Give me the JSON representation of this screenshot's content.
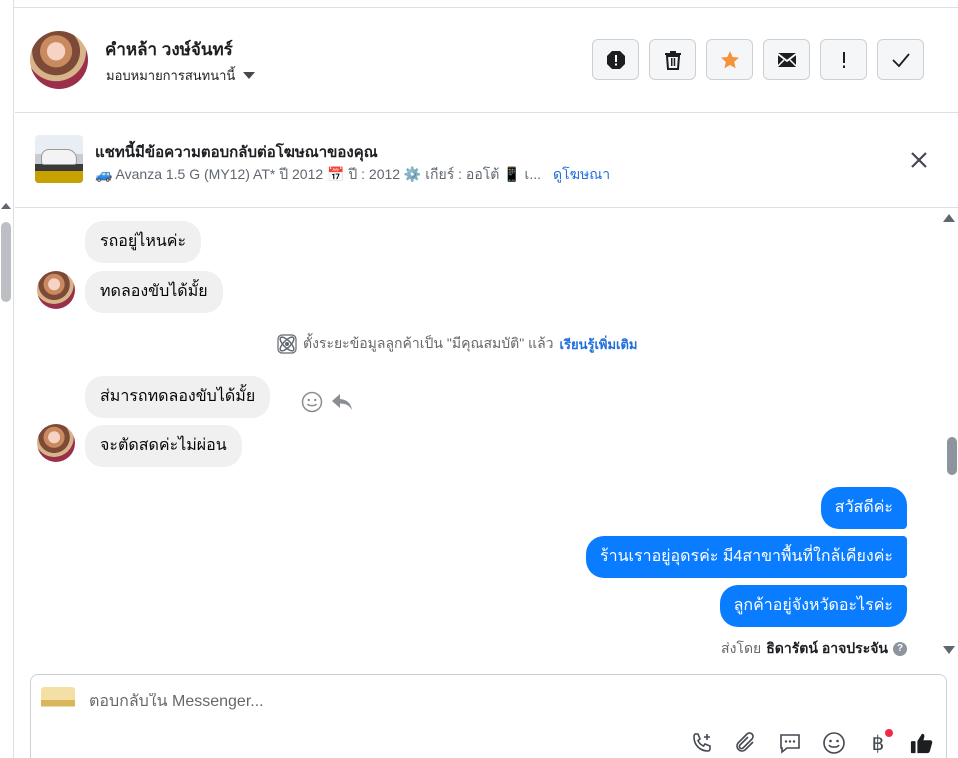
{
  "header": {
    "contact_name": "คำหล้า วงษ์จันทร์",
    "assign_label": "มอบหมายการสนทนานี้",
    "actions": [
      {
        "icon": "alert-circle-icon"
      },
      {
        "icon": "trash-icon"
      },
      {
        "icon": "star-icon"
      },
      {
        "icon": "envelope-icon"
      },
      {
        "icon": "exclamation-icon"
      },
      {
        "icon": "checkmark-icon"
      }
    ]
  },
  "ad_banner": {
    "title": "แชทนี้มีข้อความตอบกลับต่อโฆษณาของคุณ",
    "ad_text": "🚙 Avanza 1.5 G (MY12) AT* ปี 2012 📅 ปี : 2012 ⚙️ เกียร์ : ออโต้ 📱 เ...",
    "view_ad_link": "ดูโฆษณา"
  },
  "conversation": {
    "incoming_group_1": [
      "รถอยู่ไหนค่ะ",
      "ทดลองขับได้มั้ย"
    ],
    "system_note": {
      "text": "ตั้งระยะข้อมูลลูกค้าเป็น \"มีคุณสมบัติ\" แล้ว",
      "link": "เรียนรู้เพิ่มเติม"
    },
    "incoming_group_2": [
      "ส่มารถทดลองขับได้มั้ย",
      "จะตัดสดค่ะไม่ผ่อน"
    ],
    "outgoing": [
      "สวัสดีค่ะ",
      "ร้านเราอยู่อุดรค่ะ มี4สาขาพื้นที่ใกล้เคียงค่ะ",
      "ลูกค้าอยู่จังหวัดอะไรค่ะ"
    ],
    "sent_by_prefix": "ส่งโดย",
    "sent_by_name": "ธิดารัตน์ อาจประจัน"
  },
  "composer": {
    "placeholder": "ตอบกลับใน Messenger...",
    "baht_symbol": "฿"
  },
  "colors": {
    "outgoing_bubble": "#0a7cff",
    "incoming_bubble": "#f0f0f0",
    "star": "#f7923b",
    "link": "#216fdb"
  }
}
